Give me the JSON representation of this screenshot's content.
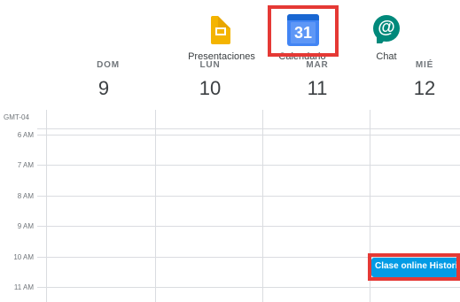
{
  "launcher": {
    "apps": [
      {
        "name": "Presentaciones",
        "icon": "slides-icon"
      },
      {
        "name": "Calendario",
        "icon": "calendar-icon",
        "icon_text": "31"
      },
      {
        "name": "Chat",
        "icon": "chat-icon",
        "icon_text": "@"
      }
    ]
  },
  "calendar": {
    "timezone": "GMT-04",
    "days": [
      {
        "name": "DOM",
        "number": "9"
      },
      {
        "name": "LUN",
        "number": "10"
      },
      {
        "name": "MAR",
        "number": "11"
      },
      {
        "name": "MIÉ",
        "number": "12"
      }
    ],
    "hours": [
      "6 AM",
      "7 AM",
      "8 AM",
      "9 AM",
      "10 AM",
      "11 AM"
    ],
    "events": [
      {
        "title": "Clase online Historia",
        "day": "MIÉ",
        "start": "10 AM",
        "color": "#039be5"
      }
    ]
  },
  "colors": {
    "highlight": "#e53935",
    "grid": "#dadce0",
    "event": "#039be5"
  }
}
